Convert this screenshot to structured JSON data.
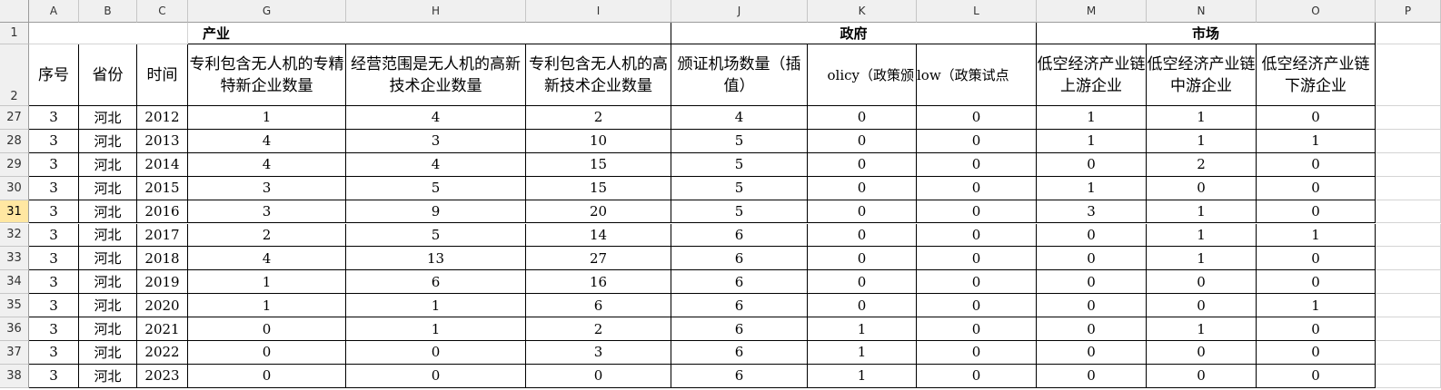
{
  "columns": [
    "A",
    "B",
    "C",
    "G",
    "H",
    "I",
    "J",
    "K",
    "L",
    "M",
    "N",
    "O",
    "P"
  ],
  "active_column": "",
  "active_row": "31",
  "groups": {
    "industry": "产业",
    "government": "政府",
    "market": "市场"
  },
  "header_row_numbers": [
    "1",
    "2"
  ],
  "headers": [
    "序号",
    "省份",
    "时间",
    "专利包含无人机的专精特新企业数量",
    "经营范围是无人机的高新技术企业数量",
    "专利包含无人机的高新技术企业数量",
    "颁证机场数量（插值）",
    "olicy（政策颁",
    "low（政策试点",
    "低空经济产业链上游企业",
    "低空经济产业链中游企业",
    "低空经济产业链下游企业"
  ],
  "rows": [
    {
      "row": "27",
      "cells": [
        "3",
        "河北",
        "2012",
        "1",
        "4",
        "2",
        "4",
        "0",
        "0",
        "1",
        "1",
        "0"
      ]
    },
    {
      "row": "28",
      "cells": [
        "3",
        "河北",
        "2013",
        "4",
        "3",
        "10",
        "5",
        "0",
        "0",
        "1",
        "1",
        "1"
      ]
    },
    {
      "row": "29",
      "cells": [
        "3",
        "河北",
        "2014",
        "4",
        "4",
        "15",
        "5",
        "0",
        "0",
        "0",
        "2",
        "0"
      ]
    },
    {
      "row": "30",
      "cells": [
        "3",
        "河北",
        "2015",
        "3",
        "5",
        "15",
        "5",
        "0",
        "0",
        "1",
        "0",
        "0"
      ]
    },
    {
      "row": "31",
      "cells": [
        "3",
        "河北",
        "2016",
        "3",
        "9",
        "20",
        "5",
        "0",
        "0",
        "3",
        "1",
        "0"
      ]
    },
    {
      "row": "32",
      "cells": [
        "3",
        "河北",
        "2017",
        "2",
        "5",
        "14",
        "6",
        "0",
        "0",
        "0",
        "1",
        "1"
      ]
    },
    {
      "row": "33",
      "cells": [
        "3",
        "河北",
        "2018",
        "4",
        "13",
        "27",
        "6",
        "0",
        "0",
        "0",
        "1",
        "0"
      ]
    },
    {
      "row": "34",
      "cells": [
        "3",
        "河北",
        "2019",
        "1",
        "6",
        "16",
        "6",
        "0",
        "0",
        "0",
        "0",
        "0"
      ]
    },
    {
      "row": "35",
      "cells": [
        "3",
        "河北",
        "2020",
        "1",
        "1",
        "6",
        "6",
        "0",
        "0",
        "0",
        "0",
        "1"
      ]
    },
    {
      "row": "36",
      "cells": [
        "3",
        "河北",
        "2021",
        "0",
        "1",
        "2",
        "6",
        "1",
        "0",
        "0",
        "1",
        "0"
      ]
    },
    {
      "row": "37",
      "cells": [
        "3",
        "河北",
        "2022",
        "0",
        "0",
        "3",
        "6",
        "1",
        "0",
        "0",
        "0",
        "0"
      ]
    },
    {
      "row": "38",
      "cells": [
        "3",
        "河北",
        "2023",
        "0",
        "0",
        "0",
        "6",
        "1",
        "0",
        "0",
        "0",
        "0"
      ]
    }
  ]
}
